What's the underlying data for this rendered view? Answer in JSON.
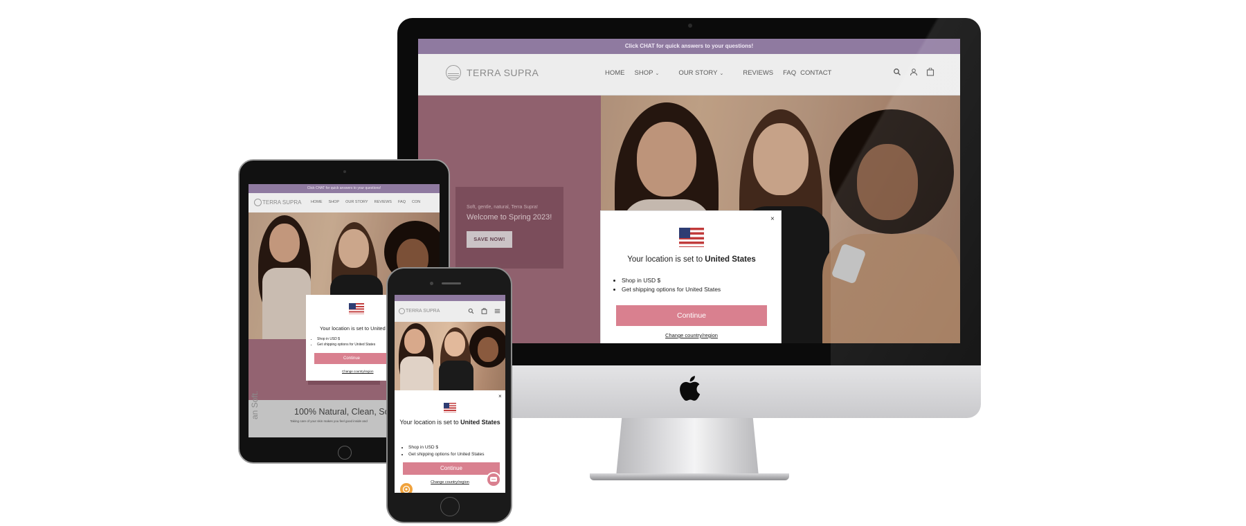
{
  "desktop": {
    "announcement": "Click CHAT for quick answers to your questions!",
    "logo_text": "TERRA SUPRA",
    "nav": [
      "HOME",
      "SHOP",
      "OUR STORY",
      "REVIEWS",
      "FAQ",
      "CONTACT"
    ],
    "hero": {
      "subtitle": "Soft, gentle, natural, Terra Supra!",
      "title": "Welcome to Spring 2023!",
      "button": "SAVE NOW!"
    },
    "modal": {
      "title_prefix": "Your location is set to",
      "country": "United States",
      "bullets": [
        "Shop in USD $",
        "Get shipping options for United States"
      ],
      "continue": "Continue",
      "change": "Change country/region",
      "close": "×"
    }
  },
  "tablet": {
    "announcement": "Click CHAT for quick answers to your questions!",
    "logo_text": "TERRA SUPRA",
    "nav": [
      "HOME",
      "SHOP",
      "OUR STORY",
      "REVIEWS",
      "FAQ",
      "CON"
    ],
    "modal": {
      "title": "Your location is set to United",
      "bullets": [
        "Shop in USD $",
        "Get shipping options for United States"
      ],
      "continue": "Continue",
      "change": "Change country/region"
    },
    "tagline": "100% Natural, Clean, Sof",
    "small_text": "Taking care of your skin makes you feel good inside and",
    "vertical_text": "an Soft."
  },
  "phone": {
    "logo_text": "TERRA SUPRA",
    "modal": {
      "title_prefix": "Your location is set to",
      "country": "United States",
      "bullets": [
        "Shop in USD $",
        "Get shipping options for United States"
      ],
      "continue": "Continue",
      "change": "Change country/region",
      "close": "×"
    }
  },
  "colors": {
    "announcement_bar": "#8f7aa0",
    "hero_pink": "#a46f7e",
    "continue_button": "#d9808f"
  }
}
